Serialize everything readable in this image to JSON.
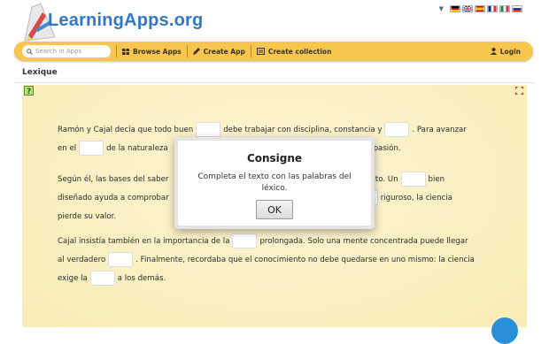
{
  "header": {
    "logo_text": "LearningApps.org",
    "logo_icon": "pencil-ruler-logo-icon",
    "lang_arrow_icon": "caret-down-icon",
    "flags": [
      "de-flag-icon",
      "gb-flag-icon",
      "es-flag-icon",
      "fr-flag-icon",
      "it-flag-icon",
      "ru-flag-icon"
    ]
  },
  "nav": {
    "search_placeholder": "Search in Apps",
    "items": [
      {
        "label": "Browse Apps",
        "icon": "grid-icon"
      },
      {
        "label": "Create App",
        "icon": "pencil-icon"
      },
      {
        "label": "Create collection",
        "icon": "collection-icon"
      }
    ],
    "login": "Login",
    "login_icon": "user-icon"
  },
  "page": {
    "title": "Lexique"
  },
  "exercise": {
    "p1": {
      "l1a": "Ramón y Cajal decía que todo buen",
      "l1b": "debe trabajar con disciplina, constancia y",
      "l1c": ". Para avanzar",
      "l2a": "en el",
      "l2b": "de la naturaleza",
      "l2c": "y pasión."
    },
    "p2": {
      "l1a": "Según él, las bases del saber",
      "l1b": "nto. Un",
      "l1c": "bien",
      "l2a": "diseñado ayuda a comprobar",
      "l2b": "riguroso, la ciencia",
      "l3": "pierde su valor."
    },
    "p3": {
      "l1a": "Cajal insistía también en la importancia de la",
      "l1b": "prolongada. Solo una mente concentrada puede llegar",
      "l2a": "al verdadero",
      "l2b": ". Finalmente, recordaba que el conocimiento no debe quedarse en uno mismo: la ciencia",
      "l3a": "exige la",
      "l3b": "a los demás."
    }
  },
  "modal": {
    "title": "Consigne",
    "text": "Completa el texto con las palabras del léxico.",
    "ok": "OK"
  },
  "colors": {
    "nav_bg": "#f6c64f",
    "content_bg": "#fbf0c2",
    "logo_blue": "#2f78c8",
    "fab_blue": "#2a8fd9"
  }
}
